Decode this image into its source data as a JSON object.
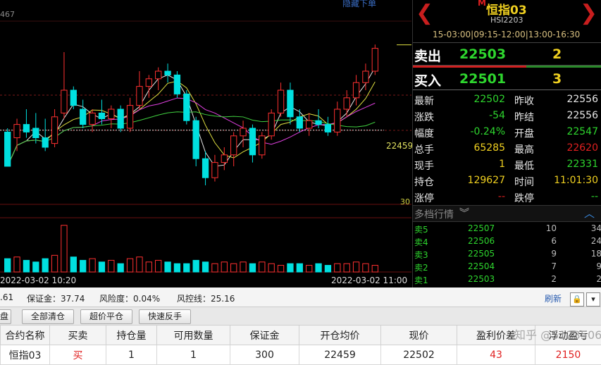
{
  "chart": {
    "hide_label": "隐藏下单",
    "price_top_partial": "467",
    "last_price_tag": "22459",
    "volume_scale_tag": "30",
    "time_start": "2022-03-02 10:20",
    "time_end": "2022-03-02 11:00",
    "colors": {
      "up": "#ff3030",
      "down": "#00e0e0",
      "ma_white": "#e8e8e8",
      "ma_yellow": "#e0e040",
      "ma_magenta": "#e040e0",
      "ma_green": "#40d040",
      "grid": "#7a1a1a"
    }
  },
  "chart_data": {
    "type": "candlestick",
    "candles": [
      {
        "o": 22458,
        "h": 22460,
        "l": 22440,
        "c": 22440
      },
      {
        "o": 22455,
        "h": 22465,
        "l": 22448,
        "c": 22462
      },
      {
        "o": 22462,
        "h": 22470,
        "l": 22455,
        "c": 22458
      },
      {
        "o": 22460,
        "h": 22468,
        "l": 22452,
        "c": 22455
      },
      {
        "o": 22455,
        "h": 22465,
        "l": 22448,
        "c": 22450
      },
      {
        "o": 22452,
        "h": 22470,
        "l": 22450,
        "c": 22466
      },
      {
        "o": 22468,
        "h": 22500,
        "l": 22465,
        "c": 22480
      },
      {
        "o": 22480,
        "h": 22482,
        "l": 22470,
        "c": 22472
      },
      {
        "o": 22470,
        "h": 22475,
        "l": 22460,
        "c": 22462
      },
      {
        "o": 22462,
        "h": 22470,
        "l": 22458,
        "c": 22468
      },
      {
        "o": 22468,
        "h": 22475,
        "l": 22462,
        "c": 22465
      },
      {
        "o": 22465,
        "h": 22472,
        "l": 22460,
        "c": 22470
      },
      {
        "o": 22470,
        "h": 22472,
        "l": 22458,
        "c": 22460
      },
      {
        "o": 22460,
        "h": 22476,
        "l": 22458,
        "c": 22472
      },
      {
        "o": 22472,
        "h": 22490,
        "l": 22470,
        "c": 22482
      },
      {
        "o": 22482,
        "h": 22488,
        "l": 22476,
        "c": 22486
      },
      {
        "o": 22486,
        "h": 22492,
        "l": 22480,
        "c": 22490
      },
      {
        "o": 22490,
        "h": 22494,
        "l": 22484,
        "c": 22488
      },
      {
        "o": 22488,
        "h": 22490,
        "l": 22476,
        "c": 22478
      },
      {
        "o": 22478,
        "h": 22480,
        "l": 22462,
        "c": 22464
      },
      {
        "o": 22464,
        "h": 22466,
        "l": 22440,
        "c": 22444
      },
      {
        "o": 22444,
        "h": 22448,
        "l": 22430,
        "c": 22434
      },
      {
        "o": 22434,
        "h": 22446,
        "l": 22432,
        "c": 22442
      },
      {
        "o": 22442,
        "h": 22450,
        "l": 22438,
        "c": 22446
      },
      {
        "o": 22446,
        "h": 22458,
        "l": 22440,
        "c": 22456
      },
      {
        "o": 22456,
        "h": 22464,
        "l": 22450,
        "c": 22460
      },
      {
        "o": 22460,
        "h": 22462,
        "l": 22442,
        "c": 22446
      },
      {
        "o": 22446,
        "h": 22458,
        "l": 22444,
        "c": 22456
      },
      {
        "o": 22456,
        "h": 22470,
        "l": 22454,
        "c": 22468
      },
      {
        "o": 22468,
        "h": 22484,
        "l": 22466,
        "c": 22480
      },
      {
        "o": 22480,
        "h": 22484,
        "l": 22462,
        "c": 22466
      },
      {
        "o": 22466,
        "h": 22470,
        "l": 22458,
        "c": 22460
      },
      {
        "o": 22460,
        "h": 22468,
        "l": 22456,
        "c": 22464
      },
      {
        "o": 22464,
        "h": 22470,
        "l": 22460,
        "c": 22462
      },
      {
        "o": 22462,
        "h": 22466,
        "l": 22456,
        "c": 22458
      },
      {
        "o": 22458,
        "h": 22474,
        "l": 22456,
        "c": 22470
      },
      {
        "o": 22470,
        "h": 22480,
        "l": 22466,
        "c": 22476
      },
      {
        "o": 22476,
        "h": 22488,
        "l": 22472,
        "c": 22484
      },
      {
        "o": 22484,
        "h": 22494,
        "l": 22480,
        "c": 22490
      },
      {
        "o": 22490,
        "h": 22504,
        "l": 22488,
        "c": 22502
      }
    ],
    "volumes": [
      8,
      9,
      7,
      6,
      8,
      10,
      28,
      9,
      7,
      8,
      6,
      7,
      5,
      8,
      9,
      6,
      7,
      6,
      5,
      5,
      7,
      6,
      5,
      6,
      5,
      6,
      5,
      6,
      5,
      4,
      5,
      5,
      4,
      5,
      4,
      5,
      5,
      6,
      5,
      4
    ],
    "y_range": [
      22420,
      22520
    ],
    "reference_line": 22459
  },
  "quote": {
    "name_mark": "M",
    "name": "恒指03",
    "code": "HSI2203",
    "hours": "15-03:00|09:15-12:00|13:00-16:30",
    "ask": {
      "label": "卖出",
      "price": "22503",
      "qty": "2"
    },
    "bid": {
      "label": "买入",
      "price": "22501",
      "qty": "3"
    },
    "rows": [
      {
        "l1": "最新",
        "v1": "22502",
        "c1": "#2ed62e",
        "l2": "昨收",
        "v2": "22556",
        "c2": "#e8e8e8"
      },
      {
        "l1": "涨跌",
        "v1": "-54",
        "c1": "#2ed62e",
        "l2": "昨结",
        "v2": "22556",
        "c2": "#e8e8e8"
      },
      {
        "l1": "幅度",
        "v1": "-0.24%",
        "c1": "#2ed62e",
        "l2": "开盘",
        "v2": "22547",
        "c2": "#2ed62e"
      },
      {
        "l1": "总手",
        "v1": "65285",
        "c1": "#f0d020",
        "l2": "最高",
        "v2": "22620",
        "c2": "#e02020"
      },
      {
        "l1": "现手",
        "v1": "1",
        "c1": "#f0d020",
        "l2": "最低",
        "v2": "22331",
        "c2": "#2ed62e"
      },
      {
        "l1": "持仓",
        "v1": "129627",
        "c1": "#f0d020",
        "l2": "时间",
        "v2": "11:01:30",
        "c2": "#f0d020"
      },
      {
        "l1": "涨停",
        "v1": "--",
        "c1": "#e02020",
        "l2": "跌停",
        "v2": "--",
        "c2": "#2ed62e"
      }
    ],
    "depth_title": "多档行情",
    "depth": [
      {
        "level": "卖5",
        "price": "22507",
        "qty": "10",
        "chg": "34"
      },
      {
        "level": "卖4",
        "price": "22506",
        "qty": "6",
        "chg": "24"
      },
      {
        "level": "卖3",
        "price": "22505",
        "qty": "9",
        "chg": "18"
      },
      {
        "level": "卖2",
        "price": "22504",
        "qty": "7",
        "chg": "9"
      },
      {
        "level": "卖1",
        "price": "22503",
        "qty": "2",
        "chg": "2"
      }
    ]
  },
  "account": {
    "partial_value": ".61",
    "margin": "保证金：37.74",
    "risk": "风险度：0.04%",
    "stop_line": "风控线：25.16",
    "refresh": "刷新",
    "lock_icon": "🔒",
    "down_icon": "▾"
  },
  "buttons": {
    "partial_tab": "盘",
    "close_all": "全部清仓",
    "over_price": "超价平仓",
    "reverse": "快速反手"
  },
  "positions": {
    "headers": [
      "合约名称",
      "买卖",
      "持仓量",
      "可用数量",
      "保证金",
      "开仓均价",
      "现价",
      "盈利价差",
      "浮动盈亏"
    ],
    "rows": [
      {
        "name": "恒指03",
        "side": "买",
        "qty": "1",
        "avail": "1",
        "margin": "300",
        "open": "22459",
        "now": "22502",
        "diff": "43",
        "pnl": "2150"
      }
    ]
  },
  "watermark": "知乎 @5123506"
}
